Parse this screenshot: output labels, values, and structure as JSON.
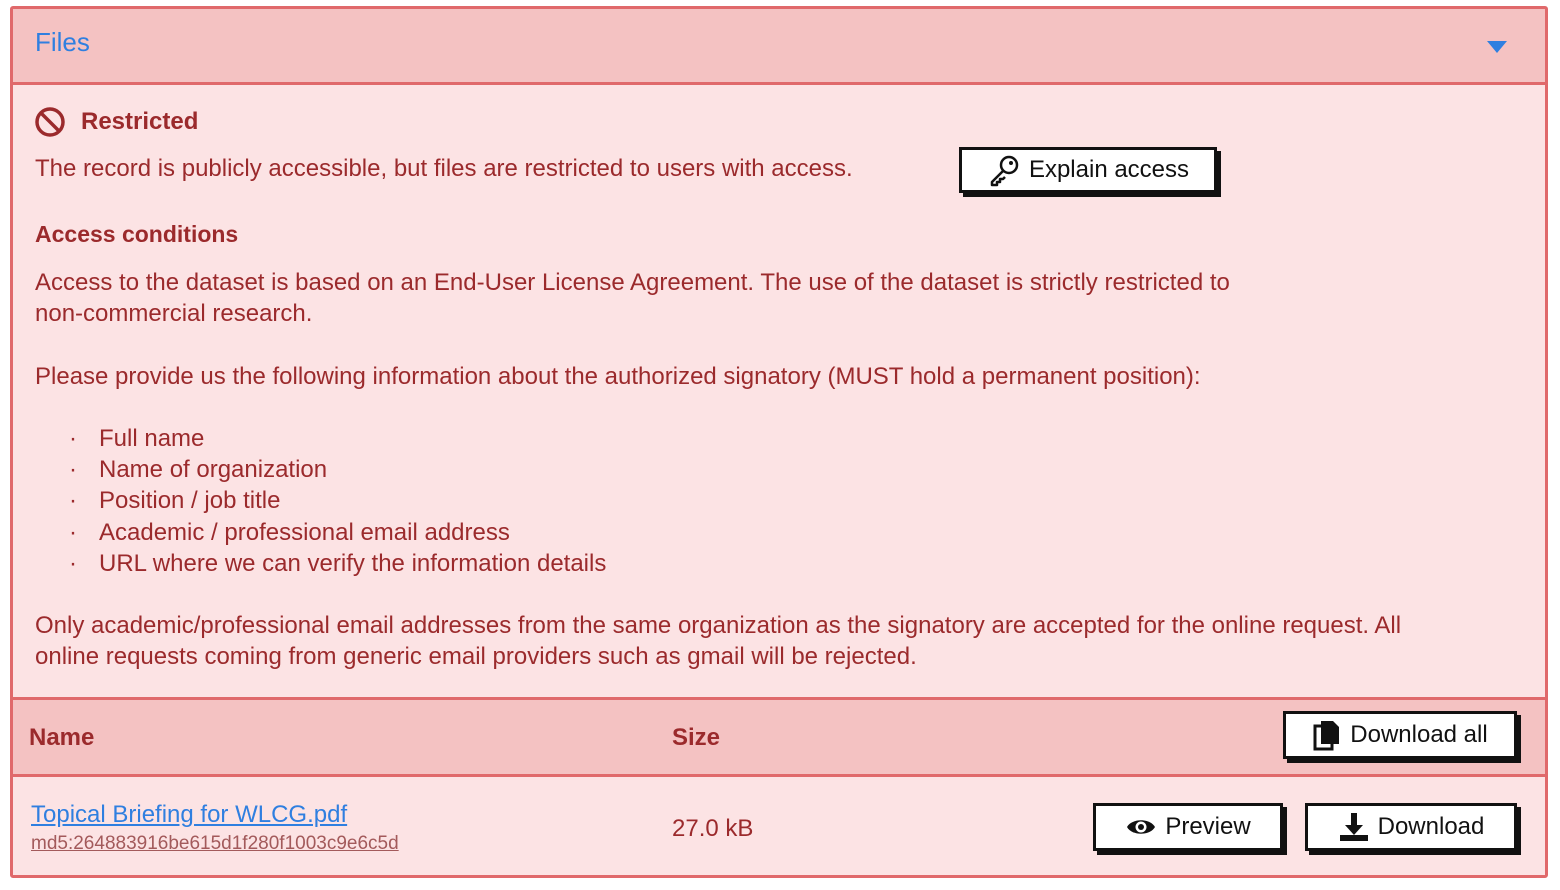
{
  "panel": {
    "title": "Files"
  },
  "access": {
    "status_label": "Restricted",
    "description": "The record is publicly accessible, but files are restricted to users with access.",
    "explain_button": "Explain access"
  },
  "conditions": {
    "title": "Access conditions",
    "paragraph1": "Access to the dataset is based on an End-User License Agreement. The use of the dataset is strictly restricted to non-commercial research.",
    "paragraph2": "Please provide us the following information about the authorized signatory (MUST hold a permanent position):",
    "items": [
      "Full name",
      "Name of organization",
      "Position / job title",
      "Academic / professional email address",
      "URL where we can verify the information details"
    ],
    "paragraph3": "Only academic/professional email addresses from the same organization as the signatory are accepted for the online request. All online requests coming from generic email providers such as gmail will be rejected."
  },
  "table": {
    "col_name": "Name",
    "col_size": "Size",
    "download_all": "Download all",
    "files": [
      {
        "name": "Topical Briefing for WLCG.pdf",
        "checksum": "md5:264883916be615d1f280f1003c9e6c5d",
        "size": "27.0 kB",
        "preview_label": "Preview",
        "download_label": "Download"
      }
    ]
  },
  "colors": {
    "accent": "#2f7fe0",
    "text": "#9b2a2c",
    "border": "#e0696b",
    "header_bg": "#f4c2c2",
    "body_bg": "#fce3e4"
  }
}
